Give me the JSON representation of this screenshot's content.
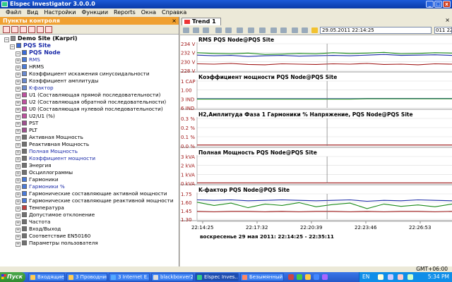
{
  "window": {
    "title": "Elspec Investigator 3.0.0.0"
  },
  "menu": [
    "Файл",
    "Вид",
    "Настройки",
    "Функции",
    "Reports",
    "Окна",
    "Справка"
  ],
  "left_panel": {
    "header": "Пункты контроля",
    "tree": [
      {
        "label": "Demo Site (Karpri)",
        "level": 0,
        "icon": "site-icon"
      },
      {
        "label": "PQS Site",
        "level": 1,
        "icon": "site-icon",
        "blue": true
      },
      {
        "label": "PQS Node",
        "level": 2,
        "icon": "node-icon",
        "blue": true
      },
      {
        "label": "RMS",
        "level": 3,
        "badge": "R",
        "color": "#4a7ad8",
        "blue": true
      },
      {
        "label": "HRMS",
        "level": 3,
        "badge": "H",
        "color": "#4a7ad8"
      },
      {
        "label": "Коэффициент искажения синусоидальности",
        "level": 3,
        "badge": "T",
        "color": "#6a8ad0"
      },
      {
        "label": "Коэффициент амплитуды",
        "level": 3,
        "badge": "C",
        "color": "#6a8ad0"
      },
      {
        "label": "K-фактор",
        "level": 3,
        "badge": "K",
        "color": "#6a8ad0",
        "blue": true
      },
      {
        "label": "U1 (Составляющая прямой последовательности)",
        "level": 3,
        "badge": "U",
        "color": "#c050a0"
      },
      {
        "label": "U2 (Составляющая обратной последовательности)",
        "level": 3,
        "badge": "U",
        "color": "#c050a0"
      },
      {
        "label": "U0 (Составляющая нулевой последовательности)",
        "level": 3,
        "badge": "U",
        "color": "#c050a0"
      },
      {
        "label": "U2/U1 (%)",
        "level": 3,
        "badge": "U",
        "color": "#c050a0"
      },
      {
        "label": "PST",
        "level": 3,
        "badge": "F",
        "color": "#a05090"
      },
      {
        "label": "PLT",
        "level": 3,
        "badge": "F",
        "color": "#a05090"
      },
      {
        "label": "Активная Мощность",
        "level": 3,
        "badge": "P",
        "color": "#707070"
      },
      {
        "label": "Реактивная Мощность",
        "level": 3,
        "badge": "Q",
        "color": "#707070"
      },
      {
        "label": "Полная Мощность",
        "level": 3,
        "badge": "S",
        "color": "#707070",
        "blue": true
      },
      {
        "label": "Коэффициент мощности",
        "level": 3,
        "badge": "P",
        "color": "#707070",
        "blue": true
      },
      {
        "label": "Энергия",
        "level": 3,
        "badge": "E",
        "color": "#707070"
      },
      {
        "label": "Осциллограммы",
        "level": 3,
        "badge": "W",
        "color": "#707070"
      },
      {
        "label": "Гармоники",
        "level": 3,
        "badge": "H",
        "color": "#4a7ad8"
      },
      {
        "label": "Гармоники %",
        "level": 3,
        "badge": "H",
        "color": "#4a7ad8",
        "blue": true
      },
      {
        "label": "Гармонические составляющие  активной мощности",
        "level": 3,
        "badge": "H",
        "color": "#4a7ad8"
      },
      {
        "label": "Гармонические составляющие  реактивной мощности",
        "level": 3,
        "badge": "H",
        "color": "#4a7ad8"
      },
      {
        "label": "Температура",
        "level": 3,
        "badge": "T",
        "color": "#c04040"
      },
      {
        "label": "Допустимое отклонение",
        "level": 3,
        "badge": "D",
        "color": "#707070"
      },
      {
        "label": "Частота",
        "level": 3,
        "badge": "F",
        "color": "#707070"
      },
      {
        "label": "Вход/Выход",
        "level": 3,
        "badge": "I",
        "color": "#707070"
      },
      {
        "label": "Соответствие EN50160",
        "level": 3,
        "badge": "E",
        "color": "#707070"
      },
      {
        "label": "Параметры пользователя",
        "level": 3,
        "badge": "U",
        "color": "#707070"
      }
    ]
  },
  "tab": {
    "label": "Trend 1"
  },
  "toolbar": {
    "time_from": "29.05.2011 22:14:25",
    "time_to": "011 22:"
  },
  "colors": {
    "green": "#1a8a1a",
    "blue": "#1a2aa8",
    "red": "#a01818",
    "accent": "#f0a030"
  },
  "chart_data": [
    {
      "type": "line",
      "title": "RMS PQS Node@PQS Site",
      "ytick_labels": [
        "234 V",
        "232 V",
        "230 V",
        "228 V"
      ],
      "ylim": [
        227,
        235
      ],
      "series": [
        {
          "color": "#1a8a1a",
          "values": [
            232.3,
            232.1,
            232.0,
            232.2,
            231.8,
            231.9,
            232.1,
            232.0,
            232.3,
            232.1,
            232.2,
            232.4,
            232.0,
            232.1,
            232.3,
            232.2
          ]
        },
        {
          "color": "#1a2aa8",
          "values": [
            231.6,
            231.4,
            231.5,
            231.2,
            231.4,
            231.5,
            231.3,
            231.4,
            231.5,
            231.4,
            231.6,
            231.8,
            231.5,
            231.6,
            231.7,
            231.5
          ]
        },
        {
          "color": "#a01818",
          "values": [
            229.0,
            228.9,
            229.1,
            228.8,
            228.7,
            229.0,
            228.9,
            228.8,
            229.0,
            228.9,
            229.1,
            228.8,
            228.9,
            228.7,
            229.0,
            228.9
          ]
        }
      ]
    },
    {
      "type": "line",
      "title": "Коэффициент мощности PQS Node@PQS Site",
      "ytick_labels": [
        "1 CAP",
        "1.00",
        "3 IND",
        "6 IND"
      ],
      "ylim": [
        0,
        3
      ],
      "series": [
        {
          "color": "#1a2aa8",
          "values": [
            1.02,
            1.02,
            1.02,
            1.02,
            1.02,
            1.02,
            1.02,
            1.02,
            1.02,
            1.02,
            1.05,
            1.05,
            1.05,
            1.05,
            1.05,
            1.05
          ]
        },
        {
          "color": "#1a8a1a",
          "values": [
            0.98,
            0.98,
            0.98,
            0.98,
            0.98,
            0.98,
            0.98,
            0.98,
            0.98,
            0.98,
            1.02,
            1.02,
            1.02,
            1.02,
            1.02,
            1.02
          ]
        }
      ]
    },
    {
      "type": "line",
      "title": "H2,Амплитуда Фаза 1 Гармоники % Напряжение, PQS Node@PQS Site",
      "ytick_labels": [
        "0.3 %",
        "0.2 %",
        "0.1 %",
        "0.0 %"
      ],
      "ylim": [
        0,
        0.3
      ],
      "series": [
        {
          "color": "#a01818",
          "values": [
            0.01,
            0.01,
            0.01,
            0.01,
            0.01,
            0.01,
            0.01,
            0.01,
            0.01,
            0.01,
            0.01,
            0.01,
            0.01,
            0.01,
            0.01,
            0.01
          ]
        }
      ]
    },
    {
      "type": "line",
      "title": "Полная Мощность PQS Node@PQS Site",
      "ytick_labels": [
        "3 kVA",
        "2 kVA",
        "1 kVA",
        "0 kVA"
      ],
      "ylim": [
        0,
        3
      ],
      "series": [
        {
          "color": "#a01818",
          "values": [
            0.05,
            0.05,
            0.05,
            0.05,
            0.05,
            0.05,
            0.05,
            0.05,
            0.05,
            0.05,
            0.05,
            0.05,
            0.05,
            0.05,
            0.05,
            0.05
          ]
        }
      ]
    },
    {
      "type": "line",
      "title": "K-фактор PQS Node@PQS Site",
      "ytick_labels": [
        "1.75",
        "1.60",
        "1.45",
        "1.30"
      ],
      "ylim": [
        1.25,
        1.8
      ],
      "series": [
        {
          "color": "#1a2aa8",
          "values": [
            1.67,
            1.66,
            1.67,
            1.65,
            1.66,
            1.67,
            1.66,
            1.65,
            1.66,
            1.67,
            1.64,
            1.66,
            1.65,
            1.67,
            1.66,
            1.65
          ]
        },
        {
          "color": "#1a8a1a",
          "values": [
            1.62,
            1.55,
            1.6,
            1.5,
            1.58,
            1.55,
            1.61,
            1.52,
            1.57,
            1.6,
            1.48,
            1.58,
            1.53,
            1.56,
            1.52,
            1.58
          ]
        },
        {
          "color": "#a01818",
          "values": [
            1.42,
            1.41,
            1.42,
            1.42,
            1.41,
            1.42,
            1.41,
            1.42,
            1.42,
            1.41,
            1.42,
            1.41,
            1.42,
            1.42,
            1.41,
            1.42
          ]
        }
      ]
    }
  ],
  "x_axis": {
    "ticks": [
      "22:14:25",
      "22:17:32",
      "22:20:39",
      "22:23:46",
      "22:26:53"
    ],
    "caption": "воскресенье 29 мая 2011: 22:14:25 - 22:35:11"
  },
  "status": {
    "timezone": "GMT+06:00"
  },
  "taskbar": {
    "start": "Пуск",
    "tasks": [
      "Входящие - П...",
      "3 Проводник",
      "3 Internet E...",
      "blackboxver2 ...",
      "Elspec Inves...",
      "Безымянный -..."
    ],
    "lang": "EN",
    "clock": "5:34 PM"
  }
}
